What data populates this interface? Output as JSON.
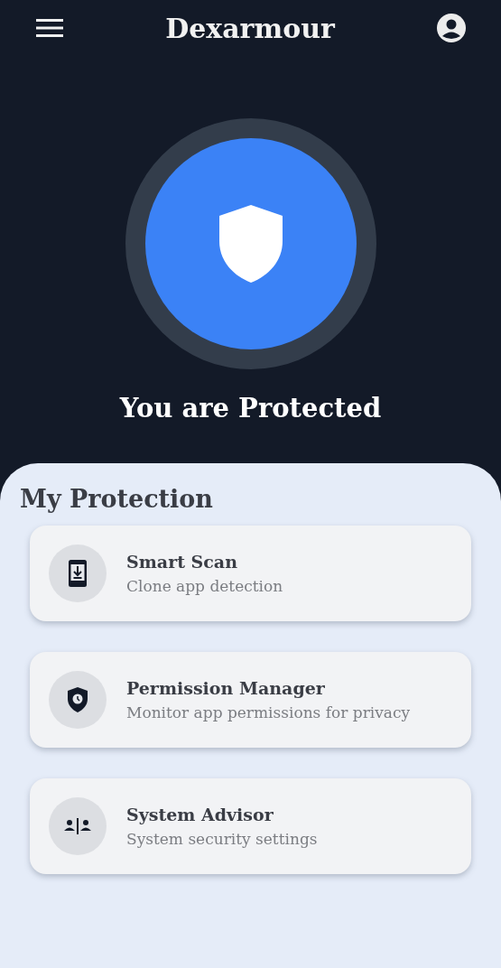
{
  "app_bar": {
    "title": "Dexarmour"
  },
  "status": {
    "text": "You are Protected",
    "protected": true
  },
  "section": {
    "title": "My Protection"
  },
  "features": [
    {
      "kind": "scan",
      "title": "Smart Scan",
      "subtitle": "Clone app detection"
    },
    {
      "kind": "permission",
      "title": "Permission Manager",
      "subtitle": "Monitor app permissions for privacy"
    },
    {
      "kind": "advisor",
      "title": "System Advisor",
      "subtitle": "System security settings"
    }
  ]
}
